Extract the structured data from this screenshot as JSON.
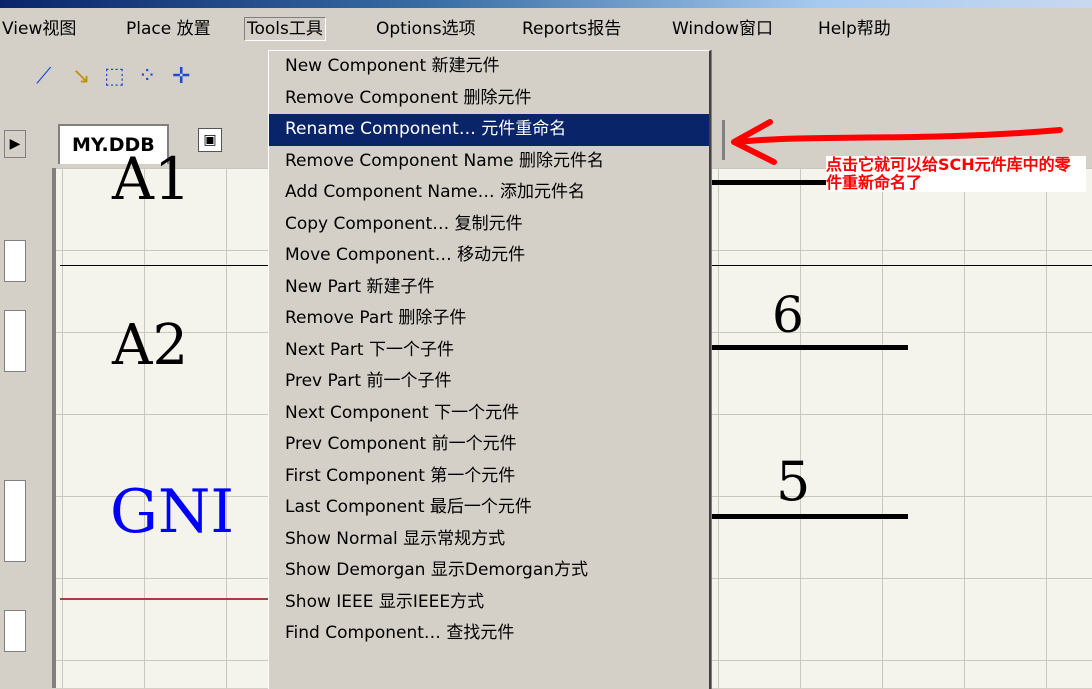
{
  "menubar": {
    "items": [
      {
        "label": "View视图"
      },
      {
        "label": "Place 放置"
      },
      {
        "label": "Tools工具"
      },
      {
        "label": "Options选项"
      },
      {
        "label": "Reports报告"
      },
      {
        "label": "Window窗口"
      },
      {
        "label": "Help帮助"
      }
    ]
  },
  "tab": {
    "label": "MY.DDB"
  },
  "tools_menu": {
    "items": [
      {
        "label": "New Component 新建元件"
      },
      {
        "label": "Remove Component 删除元件"
      },
      {
        "label": "Rename Component… 元件重命名",
        "highlighted": true
      },
      {
        "label": "Remove Component Name 删除元件名"
      },
      {
        "label": "Add Component Name… 添加元件名"
      },
      {
        "label": "Copy Component… 复制元件"
      },
      {
        "label": "Move Component… 移动元件"
      },
      {
        "label": "New Part 新建子件"
      },
      {
        "label": "Remove Part 删除子件"
      },
      {
        "label": "Next Part 下一个子件"
      },
      {
        "label": "Prev Part 前一个子件"
      },
      {
        "label": "Next Component 下一个元件"
      },
      {
        "label": "Prev Component 前一个元件"
      },
      {
        "label": "First Component 第一个元件"
      },
      {
        "label": "Last Component 最后一个元件"
      },
      {
        "label": "Show Normal 显示常规方式"
      },
      {
        "label": "Show Demorgan 显示Demorgan方式"
      },
      {
        "label": "Show IEEE 显示IEEE方式"
      },
      {
        "label": "Find Component… 查找元件"
      }
    ]
  },
  "schematic": {
    "pin_a1": "A1",
    "pin_a2": "A2",
    "pin_gnd": "GNI",
    "pin_num_6": "6",
    "pin_num_5": "5"
  },
  "annotation": {
    "text": "点击它就可以给SCH元件库中的零件重新命名了",
    "color": "#ff0000"
  },
  "colors": {
    "highlight": "#0a246a",
    "menu_bg": "#d4d0c8",
    "gnd_text": "#0000ff"
  }
}
